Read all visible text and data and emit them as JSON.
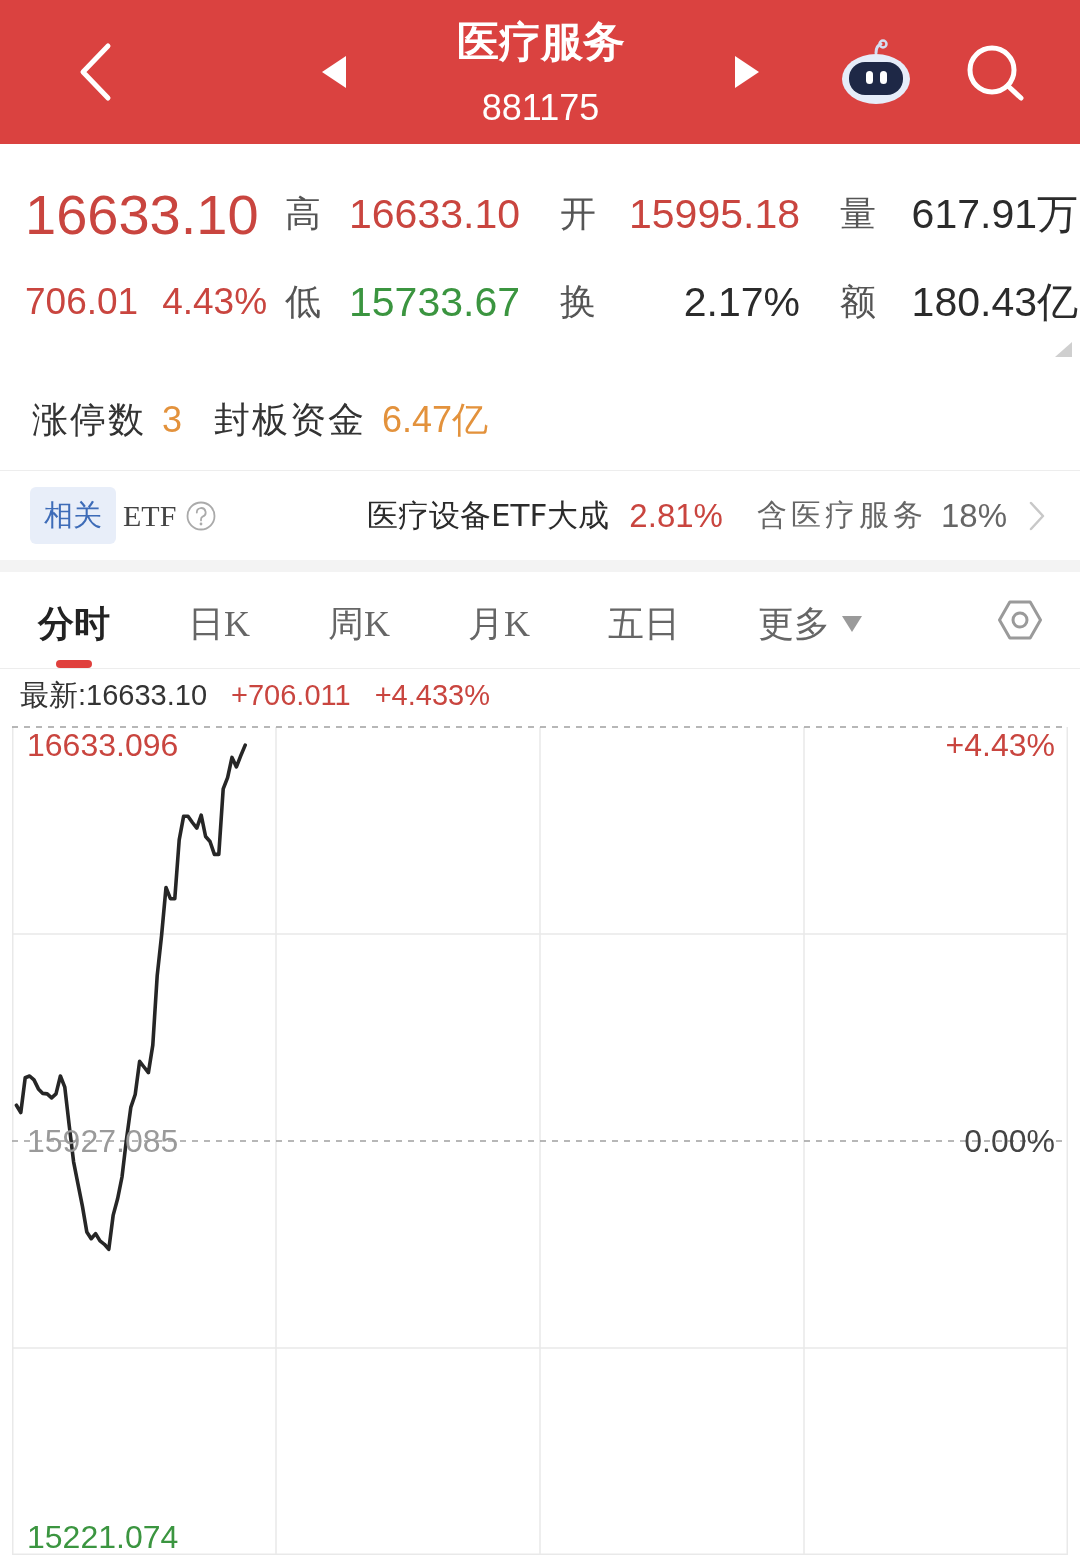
{
  "header": {
    "title": "医疗服务",
    "code": "881175"
  },
  "quote": {
    "price": "16633.10",
    "change": "706.01",
    "change_percent": "4.43%",
    "color": "#c9453f",
    "stats": [
      {
        "label": "高",
        "value": "16633.10",
        "color": "#c9453f"
      },
      {
        "label": "开",
        "value": "15995.18",
        "color": "#c9453f"
      },
      {
        "label": "量",
        "value": "617.91万",
        "color": "#2b2b2b"
      },
      {
        "label": "低",
        "value": "15733.67",
        "color": "#3b9540"
      },
      {
        "label": "换",
        "value": "2.17%",
        "color": "#2b2b2b"
      },
      {
        "label": "额",
        "value": "180.43亿",
        "color": "#2b2b2b"
      }
    ]
  },
  "limit_up": [
    {
      "label": "涨停数",
      "value": "3"
    },
    {
      "label": "封板资金",
      "value": "6.47亿"
    }
  ],
  "related_etf": {
    "badge": "相关",
    "label": "ETF",
    "name": "医疗设备ETF大成",
    "change": "2.81%",
    "color": "#c9453f",
    "holding_label": "含医疗服务",
    "holding_percent": "18%"
  },
  "tabs": [
    {
      "label": "分时",
      "kind": "tab",
      "selected": true
    },
    {
      "label": "日K",
      "kind": "tab",
      "selected": false
    },
    {
      "label": "周K",
      "kind": "tab",
      "selected": false
    },
    {
      "label": "月K",
      "kind": "tab",
      "selected": false
    },
    {
      "label": "五日",
      "kind": "tab",
      "selected": false
    },
    {
      "label": "更多",
      "kind": "dropdown",
      "selected": false
    }
  ],
  "chart": {
    "latest": "最新:16633.10",
    "change": "+706.011",
    "change_percent": "+4.433%",
    "percent_labels": [
      "+4.43%",
      "0.00%"
    ],
    "chart_data": {
      "type": "line",
      "ylim": [
        15189.0,
        16665.2
      ],
      "yticks": [
        {
          "value": 16633.096,
          "label": "16633.096"
        },
        {
          "value": 15221.074,
          "label": "15221.074"
        }
      ],
      "ref_lines": [
        {
          "axis": "y",
          "value": 15927.085,
          "label": "15927.085"
        }
      ],
      "categories": [
        null,
        null,
        null,
        null,
        null,
        null,
        null,
        null,
        null,
        null,
        null,
        null,
        null,
        null,
        null,
        null,
        null,
        null,
        null,
        null,
        null,
        null,
        null,
        null,
        null,
        null,
        null,
        null,
        null,
        null,
        null,
        null,
        null,
        null,
        null,
        null,
        null,
        null,
        null,
        null,
        null,
        null,
        null,
        null,
        null,
        null,
        null,
        null,
        null,
        null,
        null,
        null,
        null,
        null,
        null,
        null,
        null,
        null,
        null,
        null,
        null,
        null,
        null,
        null,
        null,
        null,
        null,
        null,
        null,
        null,
        null,
        null,
        null,
        null,
        null,
        null,
        null,
        null,
        null,
        null,
        null,
        null,
        null,
        null,
        null,
        null,
        null,
        null,
        null,
        null,
        null,
        null,
        null,
        null,
        null,
        null,
        null,
        null,
        null,
        null,
        null,
        null,
        null,
        null,
        null,
        null,
        null,
        null,
        null,
        null,
        null,
        null,
        null,
        null,
        null,
        null,
        null,
        null,
        null,
        null,
        null,
        null,
        null,
        null,
        null,
        null,
        null,
        null,
        null,
        null,
        null,
        null,
        null,
        null,
        null,
        null,
        null,
        null,
        null,
        null,
        null,
        null,
        null,
        null,
        null,
        null,
        null,
        null,
        null,
        null,
        null,
        null,
        null,
        null,
        null,
        null,
        null,
        null,
        null,
        null,
        null,
        null,
        null,
        null,
        null,
        null,
        null,
        null,
        null,
        null,
        null,
        null,
        null,
        null,
        null,
        null,
        null,
        null,
        null,
        null,
        null,
        null,
        null,
        null,
        null,
        null,
        null,
        null,
        null,
        null,
        null,
        null,
        null,
        null,
        null,
        null,
        null,
        null,
        null,
        null,
        null,
        null,
        null,
        null,
        null,
        null,
        null,
        null,
        null,
        null,
        null,
        null,
        null,
        null,
        null,
        null,
        null,
        null,
        null,
        null,
        null,
        null,
        null,
        null,
        null,
        null,
        null,
        null,
        null,
        null,
        null,
        null,
        null,
        null,
        null,
        null,
        null,
        null,
        null,
        null,
        null
      ],
      "series": [
        {
          "color": "#262626",
          "values": [
            null,
            15991,
            15978,
            16040,
            16043,
            16036,
            16020,
            16012,
            16011,
            16004,
            16011,
            16043,
            16023,
            15955,
            15890,
            15850,
            15811,
            15765,
            15753,
            15762,
            15749,
            15743,
            15734,
            15795,
            15824,
            15863,
            15929,
            15987,
            16010,
            16069,
            16059,
            16049,
            16098,
            16222,
            16294,
            16379,
            16359,
            16359,
            16464,
            16506,
            16506,
            16495,
            16485,
            16508,
            16470,
            16461,
            16438,
            16438,
            16555,
            16575,
            16611,
            16594,
            16614,
            16633,
            null,
            null,
            null,
            null,
            null,
            null,
            null,
            null,
            null,
            null,
            null,
            null,
            null,
            null,
            null,
            null,
            null,
            null,
            null,
            null,
            null,
            null,
            null,
            null,
            null,
            null,
            null,
            null,
            null,
            null,
            null,
            null,
            null,
            null,
            null,
            null,
            null,
            null,
            null,
            null,
            null,
            null,
            null,
            null,
            null,
            null,
            null,
            null,
            null,
            null,
            null,
            null,
            null,
            null,
            null,
            null,
            null,
            null,
            null,
            null,
            null,
            null,
            null,
            null,
            null,
            null,
            null,
            null,
            null,
            null,
            null,
            null,
            null,
            null,
            null,
            null,
            null,
            null,
            null,
            null,
            null,
            null,
            null,
            null,
            null,
            null,
            null,
            null,
            null,
            null,
            null,
            null,
            null,
            null,
            null,
            null,
            null,
            null,
            null,
            null,
            null,
            null,
            null,
            null,
            null,
            null,
            null,
            null,
            null,
            null,
            null,
            null,
            null,
            null,
            null,
            null,
            null,
            null,
            null,
            null,
            null,
            null,
            null,
            null,
            null,
            null,
            null,
            null,
            null,
            null,
            null,
            null,
            null,
            null,
            null,
            null,
            null,
            null,
            null,
            null,
            null,
            null,
            null,
            null,
            null,
            null,
            null,
            null,
            null,
            null,
            null,
            null,
            null,
            null,
            null,
            null,
            null,
            null,
            null,
            null,
            null,
            null,
            null,
            null,
            null,
            null,
            null,
            null,
            null,
            null,
            null,
            null,
            null,
            null,
            null,
            null,
            null,
            null,
            null,
            null,
            null,
            null,
            null,
            null,
            null,
            null,
            null
          ]
        }
      ]
    }
  }
}
